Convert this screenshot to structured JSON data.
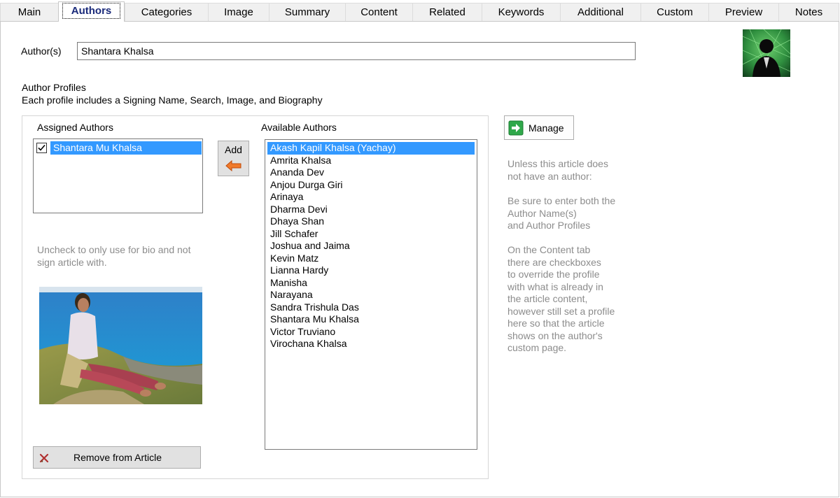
{
  "tabs": [
    {
      "label": "Main",
      "active": false
    },
    {
      "label": "Authors",
      "active": true
    },
    {
      "label": "Categories",
      "active": false
    },
    {
      "label": "Image",
      "active": false
    },
    {
      "label": "Summary",
      "active": false
    },
    {
      "label": "Content",
      "active": false
    },
    {
      "label": "Related",
      "active": false
    },
    {
      "label": "Keywords",
      "active": false
    },
    {
      "label": "Additional",
      "active": false
    },
    {
      "label": "Custom",
      "active": false
    },
    {
      "label": "Preview",
      "active": false
    },
    {
      "label": "Notes",
      "active": false
    }
  ],
  "authors_field": {
    "label": "Author(s)",
    "value": "Shantara Khalsa"
  },
  "profiles": {
    "title": "Author Profiles",
    "description": "Each profile includes a Signing Name, Search, Image, and Biography"
  },
  "assigned": {
    "label": "Assigned Authors",
    "items": [
      {
        "name": "Shantara Mu Khalsa",
        "checked": true,
        "selected": true
      }
    ],
    "uncheck_hint_line1": "Uncheck to only use for bio and not",
    "uncheck_hint_line2": "sign article with.",
    "remove_label": "Remove from Article"
  },
  "add_button": {
    "label": "Add",
    "icon": "left-arrow-icon"
  },
  "available": {
    "label": "Available Authors",
    "items": [
      "Akash Kapil Khalsa (Yachay)",
      "Amrita Khalsa",
      "Ananda Dev",
      "Anjou Durga Giri",
      "Arinaya",
      "Dharma Devi",
      "Dhaya Shan",
      "Jill Schafer",
      "Joshua and Jaima",
      "Kevin Matz",
      "Lianna Hardy",
      "Manisha",
      "Narayana",
      "Sandra Trishula Das",
      "Shantara Mu Khalsa",
      "Victor Truviano",
      "Virochana Khalsa"
    ],
    "selected_index": 0
  },
  "manage_button": {
    "label": "Manage",
    "icon": "green-arrow-icon"
  },
  "help": {
    "p1_line1": "Unless this article does",
    "p1_line2": "not have an author:",
    "p2_line1": "Be sure to enter both the",
    "p2_line2": "Author Name(s)",
    "p2_line3": "and Author Profiles",
    "p3_line1": "On the Content tab",
    "p3_line2": "there are checkboxes",
    "p3_line3": "to override the profile",
    "p3_line4": "with what is already in",
    "p3_line5": "the article content,",
    "p3_line6": "however still set a profile",
    "p3_line7": "here so that the article",
    "p3_line8": "shows on the author's",
    "p3_line9": "custom page."
  },
  "colors": {
    "selection": "#3399ff",
    "hint_text": "#8c8c8c",
    "active_tab_text": "#1a2a7a",
    "remove_icon": "#b03030",
    "add_arrow": "#e8641a"
  }
}
